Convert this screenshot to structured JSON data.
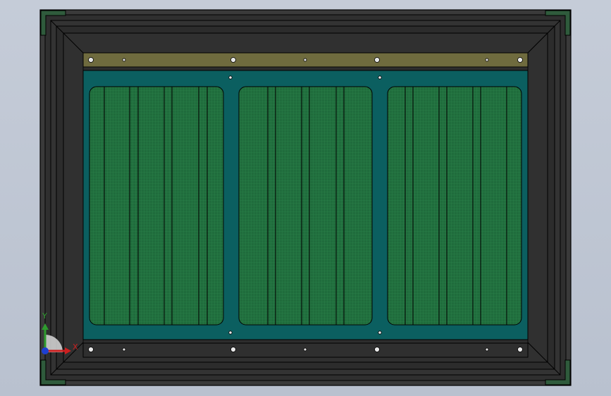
{
  "window": {
    "title": "",
    "background_color": "#bfc6d3"
  },
  "model": {
    "description_colors": {
      "frame": "#2e2e2e",
      "frame_outline": "#000000",
      "corner_pad": "#2f5b3c",
      "rail": "#6f6b3e",
      "backplate": "#0b5f60",
      "panel": "#1d6b3b",
      "panel_grid": "#2f8a4f"
    },
    "panel_count": 3,
    "rail_hole_count": 7
  },
  "triad": {
    "y_label": "Y",
    "x_label": "X",
    "y_color": "#2e9c2e",
    "x_color": "#cc1f1f",
    "z_color": "#1d3fd1"
  }
}
